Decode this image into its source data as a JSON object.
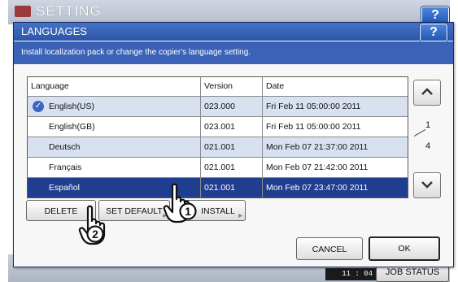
{
  "background": {
    "title": "SETTING",
    "help": "?",
    "job_status": "JOB STATUS",
    "time": "11 : 04"
  },
  "dialog": {
    "title": "LANGUAGES",
    "help": "?",
    "message": "Install localization pack or change the copier's language setting."
  },
  "table": {
    "headers": {
      "language": "Language",
      "version": "Version",
      "date": "Date"
    },
    "rows": [
      {
        "language": "English(US)",
        "version": "023.000",
        "date": "Fri Feb 11 05:00:00 2011",
        "current": true
      },
      {
        "language": "English(GB)",
        "version": "023.001",
        "date": "Fri Feb 11 05:00:00 2011"
      },
      {
        "language": "Deutsch",
        "version": "021.001",
        "date": "Mon Feb 07 21:37:00 2011"
      },
      {
        "language": "Français",
        "version": "021.001",
        "date": "Mon Feb 07 21:42:00 2011"
      },
      {
        "language": "Español",
        "version": "021.001",
        "date": "Mon Feb 07 23:47:00 2011",
        "selected": true
      }
    ]
  },
  "pager": {
    "current": "1",
    "total": "4"
  },
  "buttons": {
    "delete": "DELETE",
    "set_default": "SET DEFAULT",
    "install": "INSTALL",
    "cancel": "CANCEL",
    "ok": "OK"
  },
  "callouts": {
    "one": "1",
    "two": "2"
  }
}
